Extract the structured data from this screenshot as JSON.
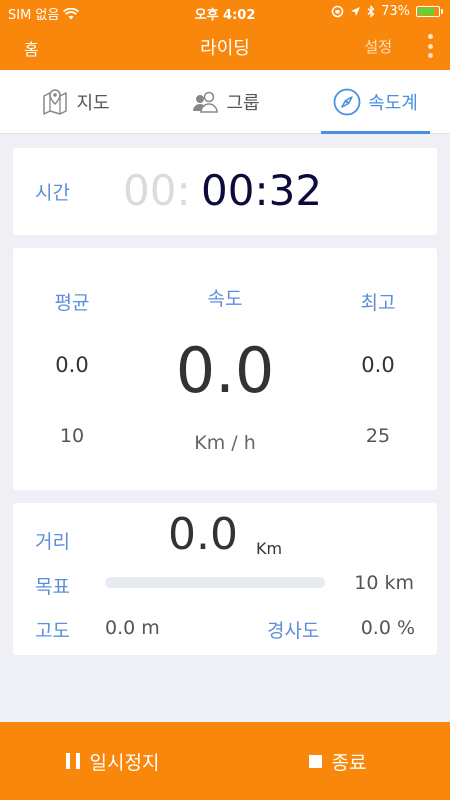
{
  "status_bar": {
    "carrier": "SIM 없음",
    "time": "오후 4:02",
    "battery": "73%",
    "battery_level": 0.73
  },
  "nav": {
    "home": "홈",
    "title": "라이딩",
    "settings": "설정"
  },
  "tabs": [
    {
      "label": "지도",
      "icon": "map-icon"
    },
    {
      "label": "그룹",
      "icon": "group-icon"
    },
    {
      "label": "속도계",
      "icon": "compass-icon",
      "active": true
    }
  ],
  "time": {
    "label": "시간",
    "dim": "00:",
    "value": "00:32"
  },
  "speed": {
    "avg_label": "평균",
    "avg_value": "0.0",
    "avg_sub": "10",
    "speed_label": "속도",
    "speed_value": "0.0",
    "unit": "Km / h",
    "max_label": "최고",
    "max_value": "0.0",
    "max_sub": "25"
  },
  "distance": {
    "label": "거리",
    "value": "0.0",
    "unit": "Km",
    "goal_label": "목표",
    "goal_value": "10 km",
    "progress": 0,
    "altitude_label": "고도",
    "altitude_value": "0.0 m",
    "grade_label": "경사도",
    "grade_value": "0.0 %"
  },
  "footer": {
    "pause": "일시정지",
    "stop": "종료"
  },
  "colors": {
    "accent": "#f9870b",
    "blue": "#4a90e2"
  }
}
